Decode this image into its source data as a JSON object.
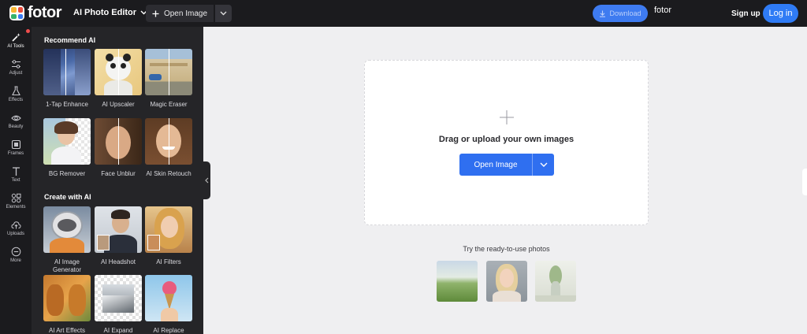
{
  "app": {
    "logo_text": "fotor",
    "tool_selector": "AI Photo Editor",
    "open_image": "Open Image",
    "download": "Download",
    "brand_label": "fotor",
    "sign_up": "Sign up",
    "log_in": "Log in"
  },
  "colors": {
    "accent": "#2f6ff0",
    "topbar": "#1b1b1e",
    "panel": "#252528",
    "canvas": "#efeff1"
  },
  "rail": [
    {
      "label": "AI Tools",
      "icon": "magic-wand-icon",
      "active": true
    },
    {
      "label": "Adjust",
      "icon": "sliders-icon"
    },
    {
      "label": "Effects",
      "icon": "flask-icon"
    },
    {
      "label": "Beauty",
      "icon": "eye-icon"
    },
    {
      "label": "Frames",
      "icon": "frame-icon"
    },
    {
      "label": "Text",
      "icon": "text-icon"
    },
    {
      "label": "Elements",
      "icon": "shapes-icon"
    },
    {
      "label": "Uploads",
      "icon": "upload-cloud-icon"
    },
    {
      "label": "More",
      "icon": "more-icon"
    }
  ],
  "panel": {
    "recommend_title": "Recommend AI",
    "recommend": [
      {
        "label": "1-Tap Enhance"
      },
      {
        "label": "AI Upscaler"
      },
      {
        "label": "Magic Eraser"
      },
      {
        "label": "BG Remover"
      },
      {
        "label": "Face Unblur"
      },
      {
        "label": "AI Skin Retouch"
      }
    ],
    "create_title": "Create with AI",
    "create": [
      {
        "label": "AI Image Generator"
      },
      {
        "label": "AI Headshot"
      },
      {
        "label": "AI Filters"
      },
      {
        "label": "AI Art Effects"
      },
      {
        "label": "AI Expand"
      },
      {
        "label": "AI Replace"
      }
    ]
  },
  "main": {
    "drop_text": "Drag or upload your own images",
    "upload_button": "Open Image",
    "try_text": "Try the ready-to-use photos"
  }
}
